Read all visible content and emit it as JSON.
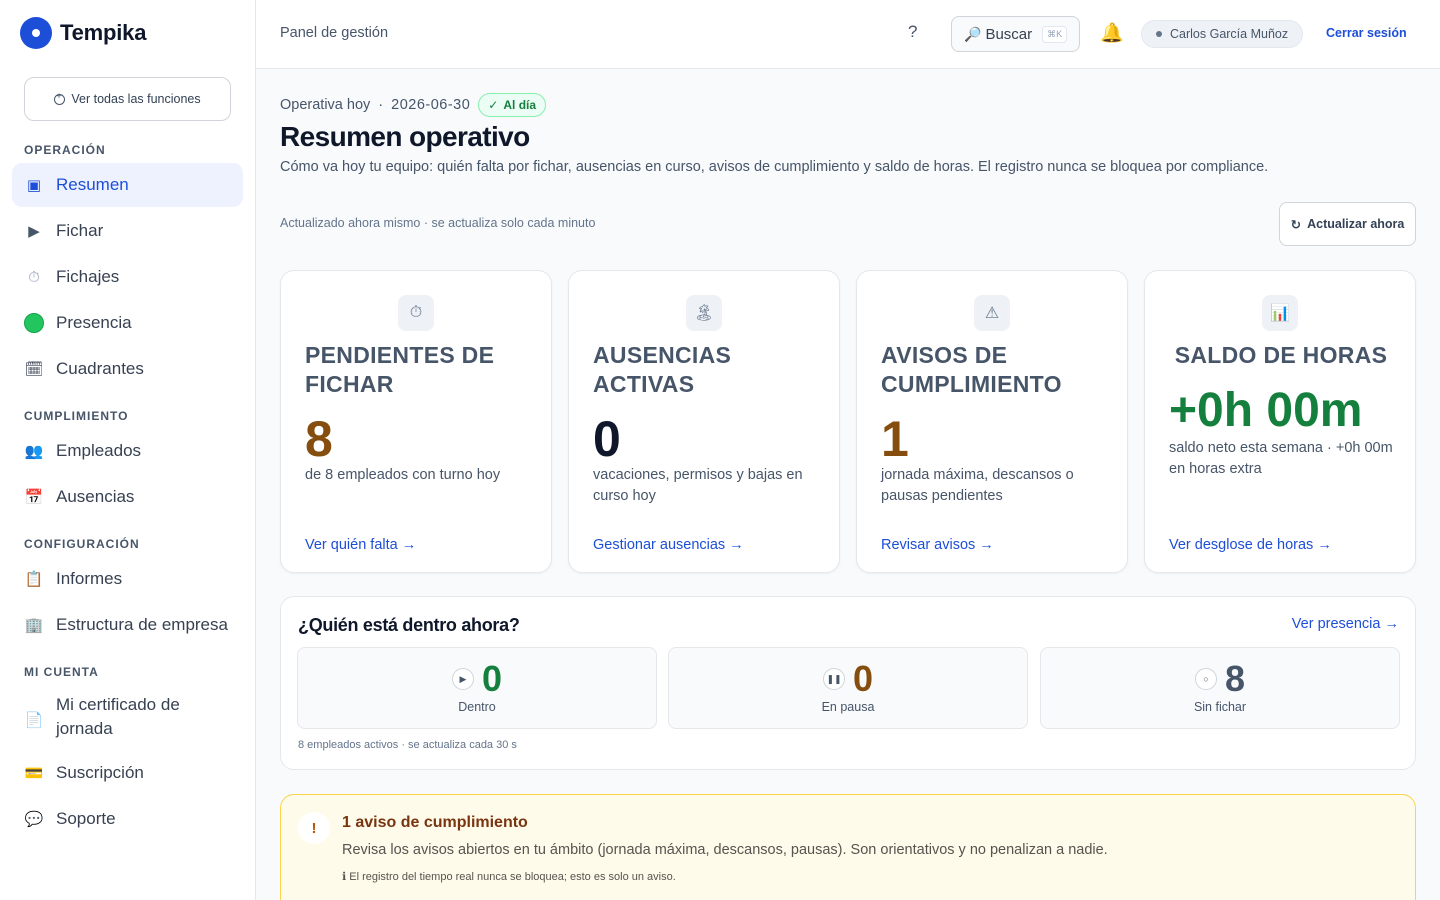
{
  "app": {
    "name": "Tempika"
  },
  "sidebar": {
    "all_features_label": "Ver todas las funciones",
    "sections": [
      "OPERACIÓN",
      "CUMPLIMIENTO",
      "CONFIGURACIÓN",
      "MI CUENTA"
    ],
    "items": [
      {
        "label": "Resumen",
        "icon": "dashboard-icon",
        "active": true
      },
      {
        "label": "Fichar",
        "icon": "play-icon"
      },
      {
        "label": "Fichajes",
        "icon": "stopwatch-icon"
      },
      {
        "label": "Presencia",
        "icon": "green-circle-icon"
      },
      {
        "label": "Cuadrantes",
        "icon": "calendar-icon"
      },
      {
        "label": "Empleados",
        "icon": "people-icon"
      },
      {
        "label": "Ausencias",
        "icon": "calendar-date-icon"
      },
      {
        "label": "Informes",
        "icon": "clipboard-icon"
      },
      {
        "label": "Estructura de empresa",
        "icon": "building-icon"
      },
      {
        "label": "Mi certificado de jornada",
        "icon": "document-icon"
      },
      {
        "label": "Suscripción",
        "icon": "credit-card-icon"
      },
      {
        "label": "Soporte",
        "icon": "speech-bubble-icon"
      }
    ]
  },
  "header": {
    "breadcrumb": "Panel de gestión",
    "help_label": "?",
    "search_label": "Buscar",
    "search_shortcut": "⌘K",
    "user_name": "Carlos García Muñoz",
    "logout_label": "Cerrar sesión"
  },
  "main": {
    "meta_prefix": "Operativa hoy",
    "meta_separator": "·",
    "date": "2026-06-30",
    "status_badge": "Al día",
    "title": "Resumen operativo",
    "description": "Cómo va hoy tu equipo: quién falta por fichar, ausencias en curso, avisos de cumplimiento y saldo de horas. El registro nunca se bloquea por compliance.",
    "updated_text": "Actualizado ahora mismo · se actualiza solo cada minuto",
    "refresh_label": "Actualizar ahora"
  },
  "cards": [
    {
      "title": "PENDIENTES DE FICHAR",
      "value": "8",
      "description": "de 8 empleados con turno hoy",
      "link": "Ver quién falta →",
      "icon": "stopwatch-icon",
      "value_color": "#854d0e"
    },
    {
      "title": "AUSENCIAS ACTIVAS",
      "value": "0",
      "description": "vacaciones, permisos y bajas en curso hoy",
      "link": "Gestionar ausencias →",
      "icon": "island-icon",
      "value_color": "#0f172a"
    },
    {
      "title": "AVISOS DE CUMPLIMIENTO",
      "value": "1",
      "description": "jornada máxima, descansos o pausas pendientes",
      "link": "Revisar avisos →",
      "icon": "warning-icon",
      "value_color": "#854d0e"
    },
    {
      "title": "SALDO DE HORAS",
      "value": "+0h 00m",
      "description": "saldo neto esta semana · +0h 00m en horas extra",
      "link": "Ver desglose de horas →",
      "icon": "bar-chart-icon",
      "value_color": "#15803d"
    }
  ],
  "presence": {
    "title": "¿Quién está dentro ahora?",
    "link": "Ver presencia →",
    "stats": [
      {
        "value": "0",
        "label": "Dentro",
        "icon": "play-icon",
        "color": "#15803d"
      },
      {
        "value": "0",
        "label": "En pausa",
        "icon": "pause-icon",
        "color": "#854d0e"
      },
      {
        "value": "8",
        "label": "Sin fichar",
        "icon": "circle-icon",
        "color": "#475569"
      }
    ],
    "footer": "8 empleados activos · se actualiza cada 30 s"
  },
  "warning": {
    "icon_text": "!",
    "title": "1 aviso de cumplimiento",
    "text": "Revisa los avisos abiertos en tu ámbito (jornada máxima, descansos, pausas). Son orientativos y no penalizan a nadie.",
    "note": "El registro del tiempo real nunca se bloquea; esto es solo un aviso."
  },
  "colors": {
    "accent": "#1d4ed8",
    "success": "#15803d",
    "warning": "#854d0e"
  }
}
